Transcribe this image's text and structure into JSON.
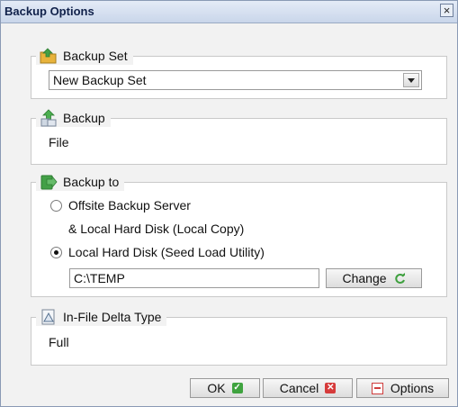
{
  "window": {
    "title": "Backup Options",
    "close_glyph": "×"
  },
  "backup_set": {
    "legend": "Backup Set",
    "icon": "folder-icon",
    "selected": "New Backup Set"
  },
  "backup": {
    "legend": "Backup",
    "icon": "backup-type-icon",
    "value": "File"
  },
  "backup_to": {
    "legend": "Backup to",
    "icon": "destination-icon",
    "option1_line1": "Offsite Backup Server",
    "option1_line2": "& Local Hard Disk (Local Copy)",
    "option2": "Local Hard Disk (Seed Load Utility)",
    "path": "C:\\TEMP",
    "change_label": "Change",
    "selected_option": "option2"
  },
  "delta": {
    "legend": "In-File Delta Type",
    "icon": "delta-icon",
    "value": "Full"
  },
  "footer": {
    "ok_label": "OK",
    "cancel_label": "Cancel",
    "options_label": "Options"
  },
  "colors": {
    "ok": "#3fa33f",
    "cancel": "#d63b3b",
    "change_refresh": "#3ea03e",
    "options": "#cf3d3d"
  }
}
